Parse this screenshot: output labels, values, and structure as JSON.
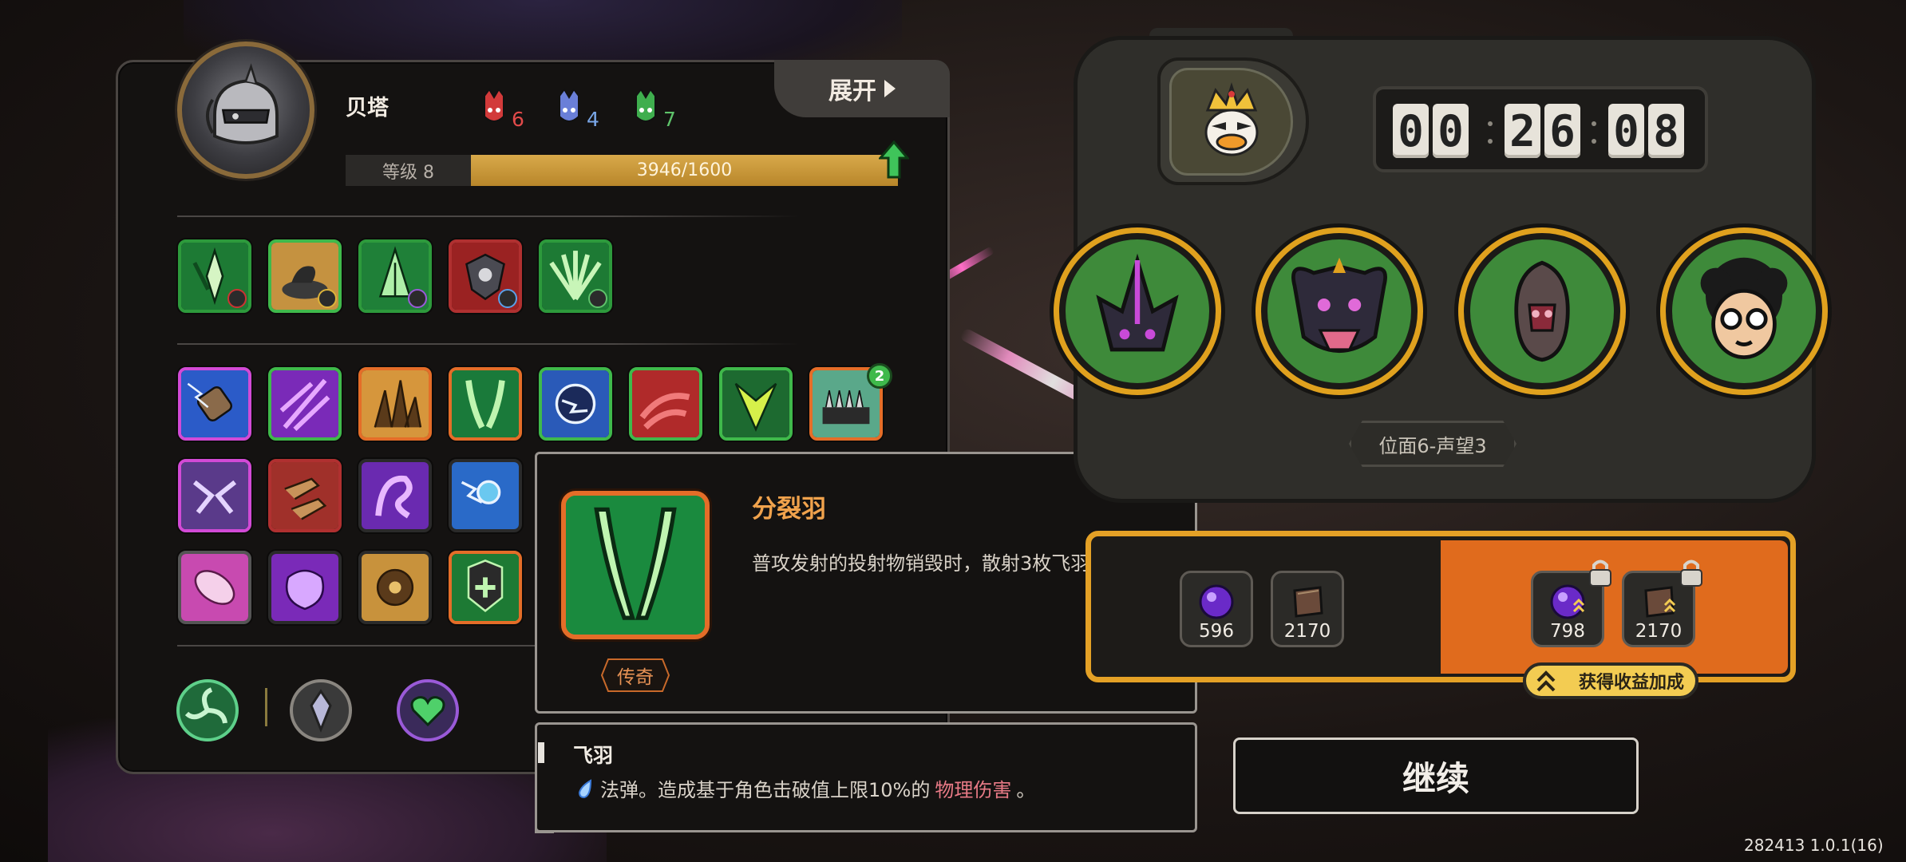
{
  "character": {
    "name": "贝塔",
    "counts": [
      {
        "color": "#e24a4a",
        "value": "6"
      },
      {
        "color": "#7aa7e8",
        "value": "4"
      },
      {
        "color": "#5ec26a",
        "value": "7"
      }
    ],
    "level_label": "等级 8",
    "xp_text": "3946/1600",
    "xp_fill": 1.0
  },
  "expand_label": "展开",
  "skill_badge": "2",
  "tooltip": {
    "title": "分裂羽",
    "description": "普攻发射的投射物销毁时，散射3枚飞羽。",
    "rarity": "传奇"
  },
  "tooltip2": {
    "title": "飞羽",
    "desc_prefix": "法弹。造成基于角色击破值上限10%的",
    "desc_highlight": "物理伤害",
    "desc_suffix": "。"
  },
  "timer": {
    "digits": [
      "0",
      "0",
      "2",
      "6",
      "0",
      "8"
    ]
  },
  "plane_label": "位面6-声望3",
  "rewards": {
    "left": [
      {
        "icon": "purple-orb-icon",
        "amount": "596"
      },
      {
        "icon": "book-icon",
        "amount": "2170"
      }
    ],
    "right": [
      {
        "icon": "purple-orb-icon",
        "amount": "798"
      },
      {
        "icon": "book-icon",
        "amount": "2170"
      }
    ],
    "bonus_label": "获得收益加成"
  },
  "continue_label": "继续",
  "version": "282413 1.0.1(16)"
}
